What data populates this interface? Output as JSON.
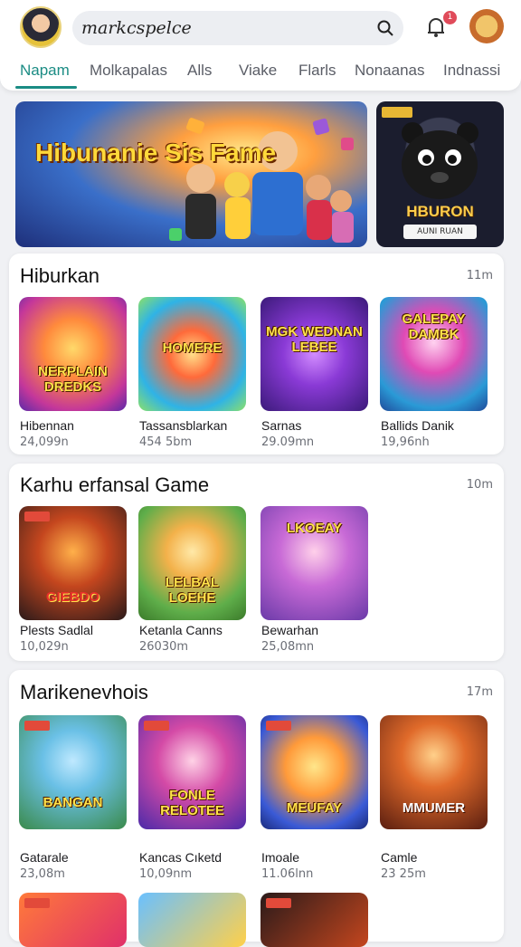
{
  "header": {
    "search_value": "markcspelce",
    "notification_count": "1"
  },
  "tabs": [
    "Napam",
    "Molkapalas",
    "Alls",
    "Viake",
    "Flarls",
    "Nonaanas",
    "Indnassi"
  ],
  "featured": {
    "main_title": "Hibunanie Sis Fame",
    "side_title": "HBURON",
    "side_subtitle": "AUNI RUAN"
  },
  "sections": [
    {
      "title": "Hiburkan",
      "meta": "11m",
      "games": [
        {
          "art": "NERPLAIN DREDKS",
          "name": "Hibennan",
          "size": "24,099n"
        },
        {
          "art": "HOMERE",
          "name": "Tassansblarkan",
          "size": "454 5bm"
        },
        {
          "art": "MGK WEDNAN LEBEE",
          "name": "Sarnas",
          "size": "29.09mn"
        },
        {
          "art": "GALEPAY DAMBK",
          "name": "Ballids Danik",
          "size": "19,96nh"
        }
      ]
    },
    {
      "title": "Karhu erfansal Game",
      "meta": "10m",
      "games": [
        {
          "art": "GIEBDO",
          "name": "Plests Sadlal",
          "size": "10,029n"
        },
        {
          "art": "LELBAL LOEHE",
          "name": "Ketanla Canns",
          "size": "26030m"
        },
        {
          "art": "LKOEAY",
          "name": "Bewarhan",
          "size": "25,08mn"
        }
      ]
    },
    {
      "title": "Marikenevhois",
      "meta": "17m",
      "games": [
        {
          "art": "BANGAN",
          "name": "Gatarale",
          "size": "23,08m"
        },
        {
          "art": "FONLE RELOTEE",
          "name": "Kancas Cıketd",
          "size": "10,09nm"
        },
        {
          "art": "MEUFAY",
          "name": "Imoale",
          "size": "11.06lnn"
        },
        {
          "art": "MMUMER",
          "name": "Camle",
          "size": "23 25m"
        }
      ]
    }
  ],
  "colors": {
    "accent": "#1b8c84",
    "badge": "#e04b5a"
  }
}
